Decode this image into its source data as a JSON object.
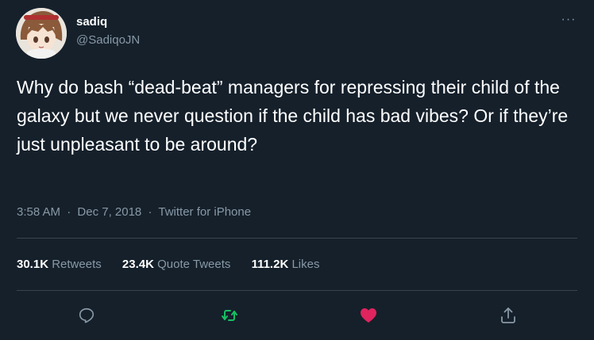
{
  "user": {
    "display_name": "sadiq",
    "handle": "@SadiqoJN"
  },
  "tweet": {
    "text": "Why do bash “dead-beat” managers for repressing their child of the galaxy but we never question if the child has bad vibes? Or if they’re just unpleasant to be around?",
    "time": "3:58 AM",
    "separator": "·",
    "date": "Dec 7, 2018",
    "source": "Twitter for iPhone"
  },
  "stats": {
    "retweets_count": "30.1K",
    "retweets_label": "Retweets",
    "quotes_count": "23.4K",
    "quotes_label": "Quote Tweets",
    "likes_count": "111.2K",
    "likes_label": "Likes"
  },
  "more_glyph": "···",
  "icons": {
    "reply": "reply-icon",
    "retweet": "retweet-icon",
    "like": "heart-icon",
    "share": "share-icon",
    "more": "more-icon"
  },
  "colors": {
    "background": "#15202b",
    "secondary_text": "#8899a6",
    "divider": "#38444d",
    "retweet_active": "#17bf63",
    "like_active": "#e0245e"
  }
}
